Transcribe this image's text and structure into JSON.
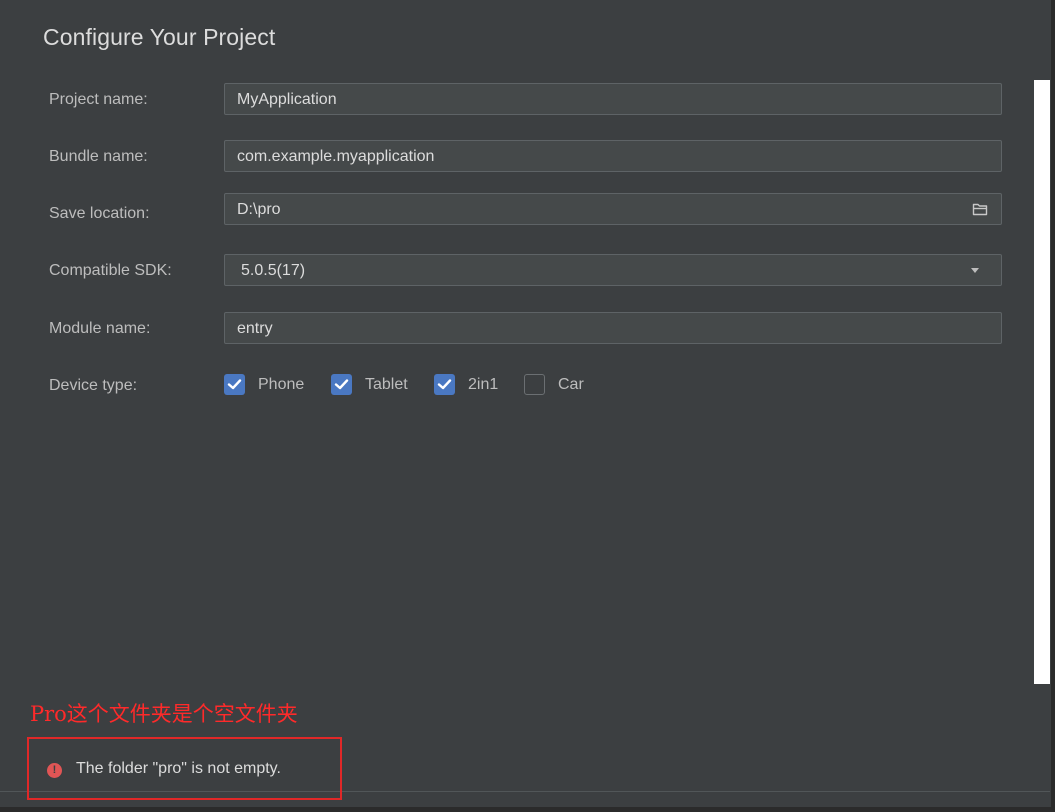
{
  "title": "Configure Your Project",
  "form": {
    "project_name": {
      "label": "Project name:",
      "value": "MyApplication"
    },
    "bundle_name": {
      "label": "Bundle name:",
      "value": "com.example.myapplication"
    },
    "save_location": {
      "label": "Save location:",
      "value": "D:\\pro",
      "icon": "folder-icon"
    },
    "compatible_sdk": {
      "label": "Compatible SDK:",
      "value": "5.0.5(17)",
      "icon": "chevron-down-icon"
    },
    "module_name": {
      "label": "Module name:",
      "value": "entry"
    },
    "device_type": {
      "label": "Device type:",
      "options": [
        {
          "label": "Phone",
          "checked": true
        },
        {
          "label": "Tablet",
          "checked": true
        },
        {
          "label": "2in1",
          "checked": true
        },
        {
          "label": "Car",
          "checked": false
        }
      ]
    }
  },
  "annotation": {
    "text": "Pro这个文件夹是个空文件夹",
    "color": "#ff2a2a"
  },
  "error": {
    "icon": "error-icon",
    "text": "The folder \"pro\" is not empty.",
    "color": "#e05555"
  },
  "colors": {
    "background": "#3c3f41",
    "field": "#45494a",
    "checkbox": "#4a78c2"
  }
}
